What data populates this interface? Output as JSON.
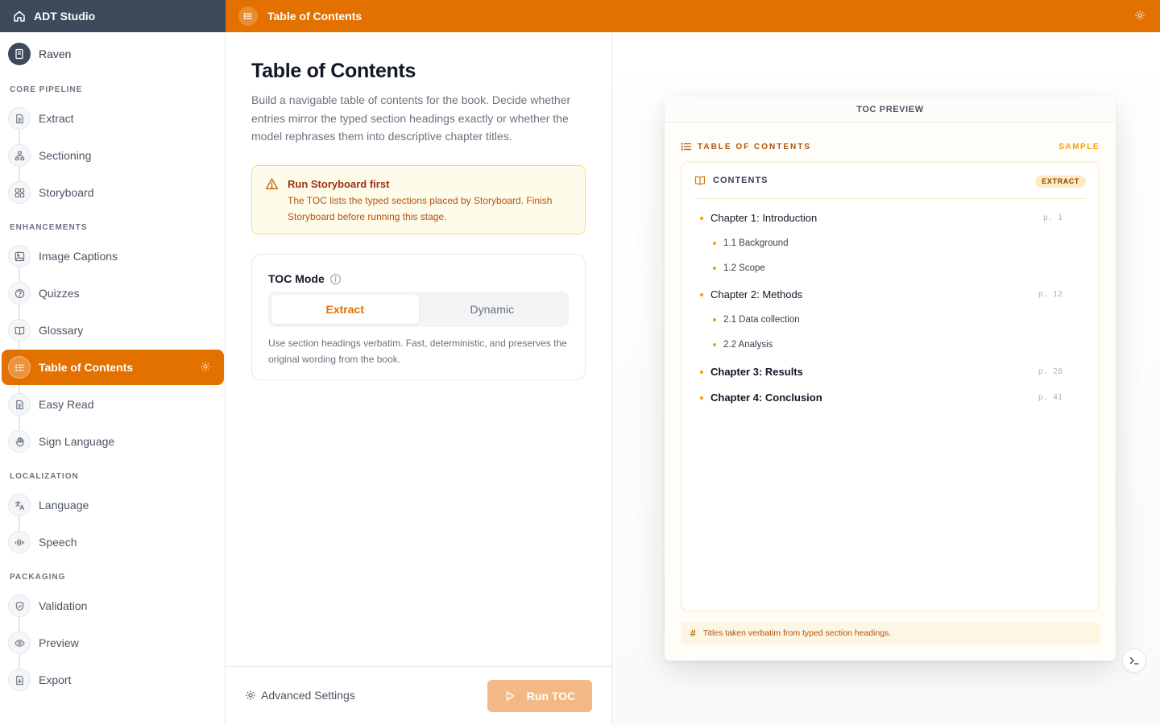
{
  "app": {
    "title": "ADT Studio"
  },
  "stage_bar": {
    "title": "Table of Contents"
  },
  "sidebar": {
    "book": {
      "name": "Raven"
    },
    "sections": [
      {
        "label": "CORE PIPELINE",
        "items": [
          {
            "label": "Extract",
            "icon": "document-icon"
          },
          {
            "label": "Sectioning",
            "icon": "sitemap-icon"
          },
          {
            "label": "Storyboard",
            "icon": "grid-icon"
          }
        ]
      },
      {
        "label": "ENHANCEMENTS",
        "items": [
          {
            "label": "Image Captions",
            "icon": "image-icon"
          },
          {
            "label": "Quizzes",
            "icon": "question-circle-icon"
          },
          {
            "label": "Glossary",
            "icon": "book-open-icon"
          },
          {
            "label": "Table of Contents",
            "icon": "list-icon",
            "active": true
          },
          {
            "label": "Easy Read",
            "icon": "document-icon"
          },
          {
            "label": "Sign Language",
            "icon": "hand-icon"
          }
        ]
      },
      {
        "label": "LOCALIZATION",
        "items": [
          {
            "label": "Language",
            "icon": "translate-icon"
          },
          {
            "label": "Speech",
            "icon": "audio-wave-icon"
          }
        ]
      },
      {
        "label": "PACKAGING",
        "items": [
          {
            "label": "Validation",
            "icon": "shield-check-icon"
          },
          {
            "label": "Preview",
            "icon": "eye-icon"
          },
          {
            "label": "Export",
            "icon": "file-download-icon"
          }
        ]
      }
    ]
  },
  "main": {
    "title": "Table of Contents",
    "description": "Build a navigable table of contents for the book. Decide whether entries mirror the typed section headings exactly or whether the model rephrases them into descriptive chapter titles.",
    "warning": {
      "title": "Run Storyboard first",
      "text": "The TOC lists the typed sections placed by Storyboard. Finish Storyboard before running this stage."
    },
    "mode": {
      "title": "TOC Mode",
      "options": [
        "Extract",
        "Dynamic"
      ],
      "selected": "Extract",
      "description": "Use section headings verbatim. Fast, deterministic, and preserves the original wording from the book."
    },
    "footer": {
      "advanced_label": "Advanced Settings",
      "run_label": "Run TOC"
    }
  },
  "preview": {
    "header": "TOC PREVIEW",
    "bar_title": "TABLE OF CONTENTS",
    "bar_badge": "SAMPLE",
    "contents_title": "CONTENTS",
    "mode_badge": "EXTRACT",
    "entries": [
      {
        "title": "Chapter 1: Introduction",
        "page": "p. 1",
        "level": 1
      },
      {
        "title": "1.1 Background",
        "level": 2
      },
      {
        "title": "1.2 Scope",
        "level": 2
      },
      {
        "title": "Chapter 2: Methods",
        "page": "p. 12",
        "level": 1
      },
      {
        "title": "2.1 Data collection",
        "level": 2
      },
      {
        "title": "2.2 Analysis",
        "level": 2
      },
      {
        "title": "Chapter 3: Results",
        "page": "p. 28",
        "level": 1
      },
      {
        "title": "Chapter 4: Conclusion",
        "page": "p. 41",
        "level": 1
      }
    ],
    "note_symbol": "#",
    "note": "Titles taken verbatim from typed section headings."
  },
  "colors": {
    "accent": "#e37100",
    "sidebar_header": "#3d4a5c",
    "warning_bg": "#fffbeb",
    "run_button": "#f3b985"
  }
}
